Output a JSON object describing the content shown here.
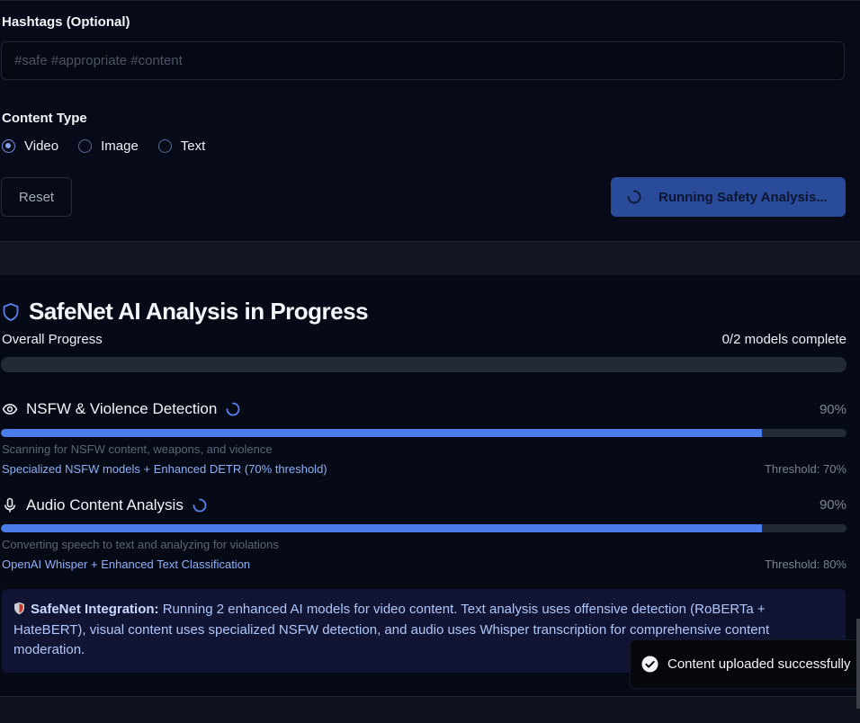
{
  "hashtags": {
    "label": "Hashtags (Optional)",
    "placeholder": "#safe #appropriate #content",
    "value": ""
  },
  "content_type": {
    "label": "Content Type",
    "options": [
      {
        "label": "Video",
        "checked": true
      },
      {
        "label": "Image",
        "checked": false
      },
      {
        "label": "Text",
        "checked": false
      }
    ]
  },
  "actions": {
    "reset_label": "Reset",
    "run_label": "Running Safety Analysis..."
  },
  "analysis": {
    "title": "SafeNet AI Analysis in Progress",
    "overall_label": "Overall Progress",
    "overall_count": "0/2 models complete",
    "overall_progress": 0,
    "models": [
      {
        "name": "NSFW & Violence Detection",
        "icon": "eye-icon",
        "percent_label": "90%",
        "progress": 0.9,
        "description": "Scanning for NSFW content, weapons, and violence",
        "tech": "Specialized NSFW models + Enhanced DETR (70% threshold)",
        "threshold": "Threshold: 70%"
      },
      {
        "name": "Audio Content Analysis",
        "icon": "microphone-icon",
        "percent_label": "90%",
        "progress": 0.9,
        "description": "Converting speech to text and analyzing for violations",
        "tech": "OpenAI Whisper + Enhanced Text Classification",
        "threshold": "Threshold: 80%"
      }
    ]
  },
  "integration": {
    "heading": "SafeNet Integration:",
    "text": "Running 2 enhanced AI models for video content. Text analysis uses offensive detection (RoBERTa + HateBERT), visual content uses specialized NSFW detection, and audio uses Whisper transcription for comprehensive content moderation."
  },
  "toast": {
    "text": "Content uploaded successfully"
  },
  "colors": {
    "accent": "#4b7cea",
    "button_bg": "#2a4a9a",
    "panel_bg": "#070b19",
    "integration_bg": "#111533"
  }
}
